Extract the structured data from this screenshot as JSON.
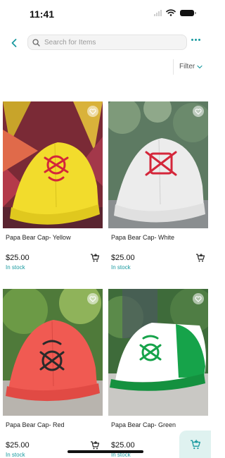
{
  "status_bar": {
    "time": "11:41",
    "icons": [
      "signal-icon",
      "wifi-icon",
      "battery-icon"
    ]
  },
  "header": {
    "back_icon": "chevron-left-icon",
    "search": {
      "placeholder": "Search for Items",
      "value": "",
      "icon": "search-icon"
    },
    "more_icon": "more-dots-icon"
  },
  "filter": {
    "label": "Filter",
    "icon": "chevron-down-icon"
  },
  "colors": {
    "accent": "#1a9aa0",
    "fab_background": "#dff2f0"
  },
  "products": [
    {
      "name": "Papa Bear Cap- Yellow",
      "price": "$25.00",
      "stock": "In stock",
      "cap_color": "#f2dc2c",
      "logo_color": "#d4263a",
      "favorite": false
    },
    {
      "name": "Papa Bear Cap- White",
      "price": "$25.00",
      "stock": "In stock",
      "cap_color": "#ececec",
      "logo_color": "#d4263a",
      "favorite": false
    },
    {
      "name": "Papa Bear Cap- Red",
      "price": "$25.00",
      "stock": "In stock",
      "cap_color": "#f05a52",
      "logo_color": "#2a2a2a",
      "favorite": false
    },
    {
      "name": "Papa Bear Cap- Green",
      "price": "$25.00",
      "stock": "In stock",
      "cap_color": "#16a34a",
      "logo_color": "#16a34a",
      "favorite": false
    }
  ]
}
